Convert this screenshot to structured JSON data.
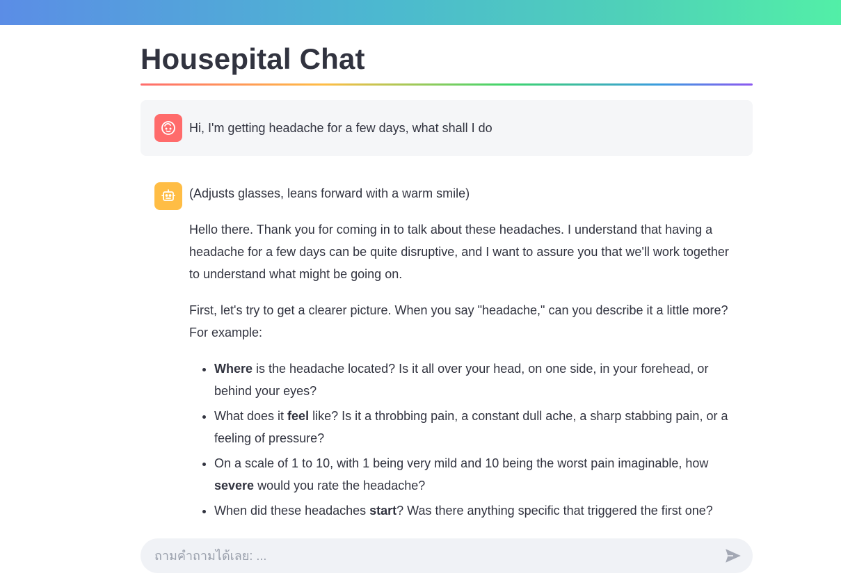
{
  "header": {
    "gradient_colors": [
      "#5b8de6",
      "#52efa7"
    ]
  },
  "page": {
    "title": "Housepital Chat"
  },
  "messages": {
    "user": {
      "avatar_icon": "face-icon",
      "avatar_color": "#ff6b6b",
      "text": "Hi, I'm getting headache for a few days, what shall I do"
    },
    "assistant": {
      "avatar_icon": "robot-icon",
      "avatar_color": "#ffbd45",
      "intro": "(Adjusts glasses, leans forward with a warm smile)",
      "para1": "Hello there. Thank you for coming in to talk about these headaches. I understand that having a headache for a few days can be quite disruptive, and I want to assure you that we'll work together to understand what might be going on.",
      "para2": "First, let's try to get a clearer picture. When you say \"headache,\" can you describe it a little more? For example:",
      "bullets": [
        {
          "pre": "",
          "bold": "Where",
          "post": " is the headache located? Is it all over your head, on one side, in your forehead, or behind your eyes?"
        },
        {
          "pre": "What does it ",
          "bold": "feel",
          "post": " like? Is it a throbbing pain, a constant dull ache, a sharp stabbing pain, or a feeling of pressure?"
        },
        {
          "pre": "On a scale of 1 to 10, with 1 being very mild and 10 being the worst pain imaginable, how ",
          "bold": "severe",
          "post": " would you rate the headache?"
        },
        {
          "pre": "When did these headaches ",
          "bold": "start",
          "post": "? Was there anything specific that triggered the first one?"
        }
      ]
    }
  },
  "chat_input": {
    "placeholder": "ถามคำถามได้เลย: ...",
    "value": "",
    "send_icon": "send-icon"
  }
}
